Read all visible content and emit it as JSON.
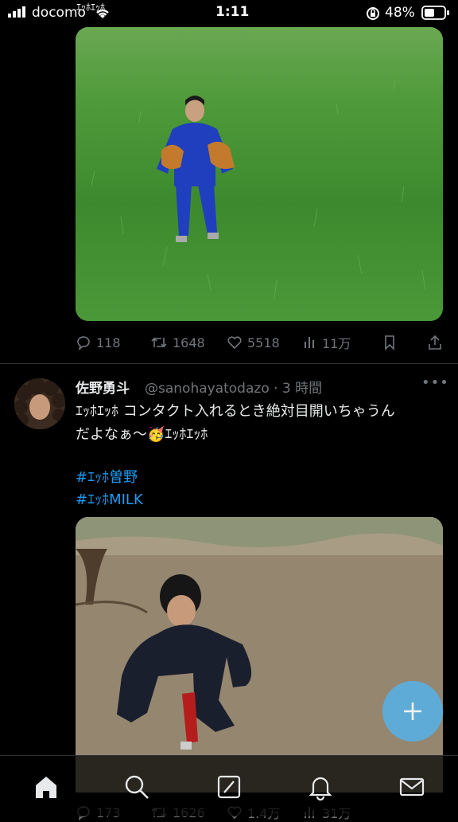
{
  "status": {
    "carrier": "docomo",
    "overlay": "ｴｯﾎｴｯﾎ",
    "time": "1:11",
    "battery": "48%"
  },
  "tweet1": {
    "stats": {
      "replies": "118",
      "retweets": "1648",
      "likes": "5518",
      "views": "11万"
    }
  },
  "tweet2": {
    "name": "佐野勇斗",
    "handle": "@sanohayatodazo",
    "time": "· 3 時間",
    "text_line1": "ｴｯﾎｴｯﾎ コンタクト入れるとき絶対目開いちゃうん",
    "text_line2a": "だよなぁ～",
    "emoji": "🥳",
    "text_line2b": "ｴｯﾎｴｯﾎ",
    "hashtag1": "#ｴｯﾎ曽野",
    "hashtag2": "#ｴｯﾎMILK",
    "stats": {
      "replies": "173",
      "retweets": "1626",
      "likes": "1.4万",
      "views": "31万"
    }
  },
  "colors": {
    "accent": "#1d9bf0",
    "muted": "#71767b",
    "background": "#000000"
  },
  "icons": [
    "home-icon",
    "search-icon",
    "grok-icon",
    "notifications-icon",
    "messages-icon",
    "compose-icon"
  ]
}
